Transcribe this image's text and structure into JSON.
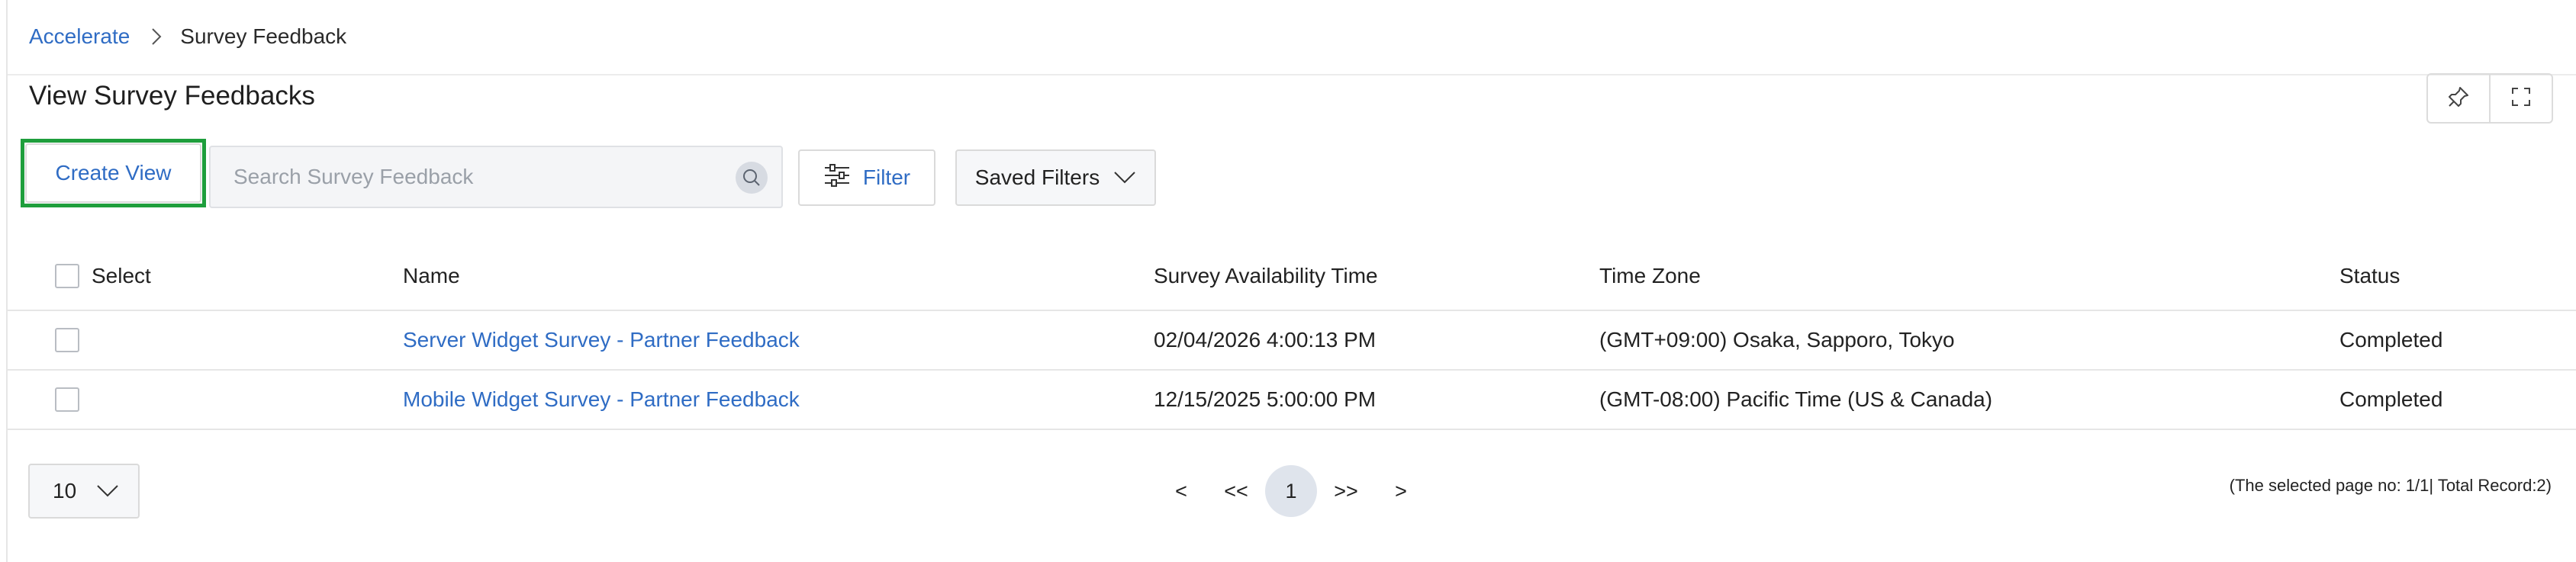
{
  "breadcrumb": {
    "root": "Accelerate",
    "current": "Survey Feedback"
  },
  "page": {
    "title": "View Survey Feedbacks"
  },
  "toolbar": {
    "create_view_label": "Create View",
    "search_placeholder": "Search Survey Feedback",
    "search_value": "",
    "filter_label": "Filter",
    "saved_filters_label": "Saved Filters"
  },
  "table": {
    "columns": {
      "select": "Select",
      "name": "Name",
      "availability": "Survey Availability Time",
      "timezone": "Time Zone",
      "status": "Status"
    },
    "rows": [
      {
        "name": "Server Widget Survey - Partner Feedback",
        "availability": "02/04/2026 4:00:13 PM",
        "timezone": "(GMT+09:00) Osaka, Sapporo, Tokyo",
        "status": "Completed"
      },
      {
        "name": "Mobile Widget Survey - Partner Feedback",
        "availability": "12/15/2025 5:00:00 PM",
        "timezone": "(GMT-08:00) Pacific Time (US & Canada)",
        "status": "Completed"
      }
    ]
  },
  "pagination": {
    "page_size": "10",
    "prev": "<",
    "first": "<<",
    "current_page": "1",
    "last": ">>",
    "next": ">",
    "info": "(The selected page no: 1/1| Total Record:2)"
  },
  "colors": {
    "link": "#2f6cc4",
    "highlight_border": "#1e9e3c",
    "active_page_bg": "#dfe4ec"
  },
  "icons": {
    "breadcrumb_separator": "chevron-right-icon",
    "pin": "pin-icon",
    "fullscreen": "fullscreen-icon",
    "search": "search-icon",
    "filter": "sliders-icon",
    "dropdown": "chevron-down-icon"
  }
}
